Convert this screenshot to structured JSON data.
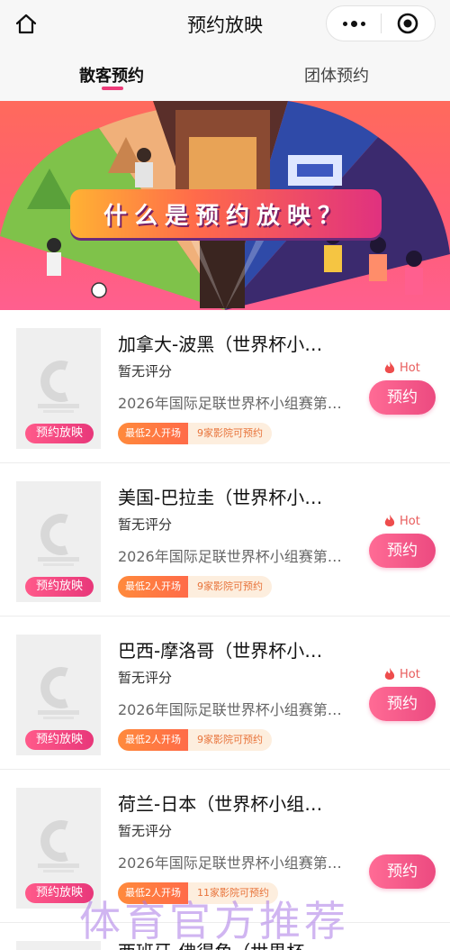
{
  "header": {
    "title": "预约放映",
    "back_icon": "home-back-icon",
    "more_icon": "more-dots-icon",
    "close_icon": "target-close-icon"
  },
  "tabs": [
    {
      "label": "散客预约",
      "active": true
    },
    {
      "label": "团体预约",
      "active": false
    }
  ],
  "banner": {
    "title": "什么是预约放映？"
  },
  "movies": [
    {
      "title": "加拿大-波黑（世界杯小…",
      "rating": "暂无评分",
      "desc": "2026年国际足联世界杯小组赛第…",
      "tag_min": "最低2人开场",
      "tag_cinemas": "9家影院可预约",
      "badge": "预约放映",
      "hot": "Hot",
      "button": "预约"
    },
    {
      "title": "美国-巴拉圭（世界杯小…",
      "rating": "暂无评分",
      "desc": "2026年国际足联世界杯小组赛第…",
      "tag_min": "最低2人开场",
      "tag_cinemas": "9家影院可预约",
      "badge": "预约放映",
      "hot": "Hot",
      "button": "预约"
    },
    {
      "title": "巴西-摩洛哥（世界杯小…",
      "rating": "暂无评分",
      "desc": "2026年国际足联世界杯小组赛第…",
      "tag_min": "最低2人开场",
      "tag_cinemas": "9家影院可预约",
      "badge": "预约放映",
      "hot": "Hot",
      "button": "预约"
    },
    {
      "title": "荷兰-日本（世界杯小组…",
      "rating": "暂无评分",
      "desc": "2026年国际足联世界杯小组赛第…",
      "tag_min": "最低2人开场",
      "tag_cinemas": "11家影院可预约",
      "badge": "预约放映",
      "hot": "",
      "button": "预约"
    }
  ],
  "partial_movie_title": "西班牙-佛得角（世界杯…",
  "watermark": "体育官方推荐",
  "colors": {
    "accent": "#ec4a80",
    "tag_orange": "#ff7a40",
    "hot": "#e85b5b"
  }
}
